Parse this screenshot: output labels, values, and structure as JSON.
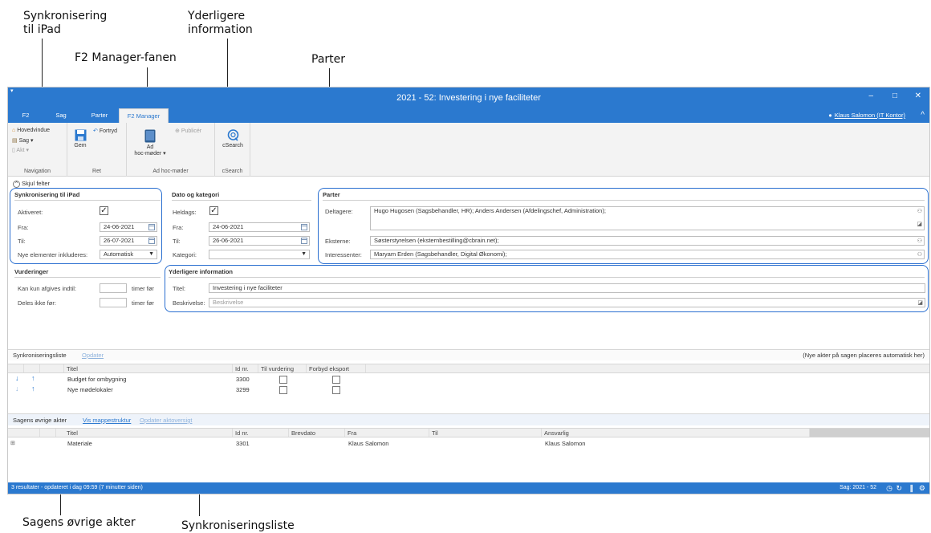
{
  "callouts": {
    "sync_ipad_l1": "Synkronisering",
    "sync_ipad_l2": "til iPad",
    "extra_info_l1": "Yderligere",
    "extra_info_l2": "information",
    "f2_manager_tab": "F2 Manager-fanen",
    "parter": "Parter",
    "other_docs": "Sagens øvrige akter",
    "sync_list": "Synkroniseringsliste"
  },
  "window": {
    "title": "2021 - 52: Investering i nye faciliteter",
    "min": "–",
    "max": "□",
    "close": "✕"
  },
  "tabs": [
    "F2",
    "Sag",
    "Parter",
    "F2 Manager"
  ],
  "active_tab": "F2 Manager",
  "user": "Klaus Salomon (IT Kontor)",
  "ribbon": {
    "navigation": {
      "label": "Navigation",
      "hovedvindue": "Hovedvindue",
      "sag": "Sag ▾",
      "akt": "Akt ▾"
    },
    "ret": {
      "label": "Ret",
      "gem": "Gem",
      "fortryd": "Fortryd"
    },
    "adhoc": {
      "label": "Ad hoc-møder",
      "btn_l1": "Ad",
      "btn_l2": "hoc-møder ▾",
      "publicer": "Publicér"
    },
    "csearch": {
      "label": "cSearch",
      "btn": "cSearch"
    }
  },
  "hide_fields": "Skjul felter",
  "sync": {
    "title": "Synkronisering til iPad",
    "aktiveret_label": "Aktiveret:",
    "fra_label": "Fra:",
    "fra_value": "24-06-2021",
    "til_label": "Til:",
    "til_value": "26-07-2021",
    "nye_label": "Nye elementer inkluderes:",
    "nye_value": "Automatisk"
  },
  "dato": {
    "title": "Dato og kategori",
    "heldags_label": "Heldags:",
    "fra_label": "Fra:",
    "fra_value": "24-06-2021",
    "til_label": "Til:",
    "til_value": "26-06-2021",
    "kategori_label": "Kategori:",
    "kategori_value": ""
  },
  "parter": {
    "title": "Parter",
    "deltagere_label": "Deltagere:",
    "deltagere_value": "Hugo Hugosen (Sagsbehandler, HR); Anders Andersen (Afdelingschef, Administration);",
    "eksterne_label": "Eksterne:",
    "eksterne_value": "Søsterstyrelsen (eksternbestilling@cbrain.net);",
    "interessenter_label": "Interessenter:",
    "interessenter_value": "Maryam Erden (Sagsbehandler, Digital Økonomi);"
  },
  "vurderinger": {
    "title": "Vurderinger",
    "kan_label": "Kan kun afgives indtil:",
    "deles_label": "Deles ikke før:",
    "unit": "timer før"
  },
  "yderligere": {
    "title": "Yderligere information",
    "titel_label": "Titel:",
    "titel_value": "Investering i nye faciliteter",
    "beskrivelse_label": "Beskrivelse:",
    "beskrivelse_placeholder": "Beskrivelse"
  },
  "synclist": {
    "title": "Synkroniseringsliste",
    "update_link": "Opdater",
    "note": "(Nye akter på sagen placeres automatisk her)",
    "columns": [
      "Titel",
      "Id nr.",
      "Til vurdering",
      "Forbyd eksport"
    ],
    "rows": [
      {
        "titel": "Budget for ombygning",
        "id": "3300"
      },
      {
        "titel": "Nye mødelokaler",
        "id": "3299"
      }
    ]
  },
  "otherdocs": {
    "title": "Sagens øvrige akter",
    "link1": "Vis mappestruktur",
    "link2": "Opdater aktoversigt",
    "columns": [
      "Titel",
      "Id nr.",
      "Brevdato",
      "Fra",
      "Til",
      "Ansvarlig"
    ],
    "rows": [
      {
        "titel": "Materiale",
        "id": "3301",
        "brevdato": "",
        "fra": "Klaus Salomon",
        "til": "",
        "ansvarlig": "Klaus Salomon"
      }
    ]
  },
  "status": {
    "left": "3 resultater - opdateret i dag 09:59 (7 minutter siden)",
    "right": "Sag: 2021 - 52"
  },
  "colors": {
    "accent": "#2b79cf",
    "highlight": "#2a6fd0"
  }
}
